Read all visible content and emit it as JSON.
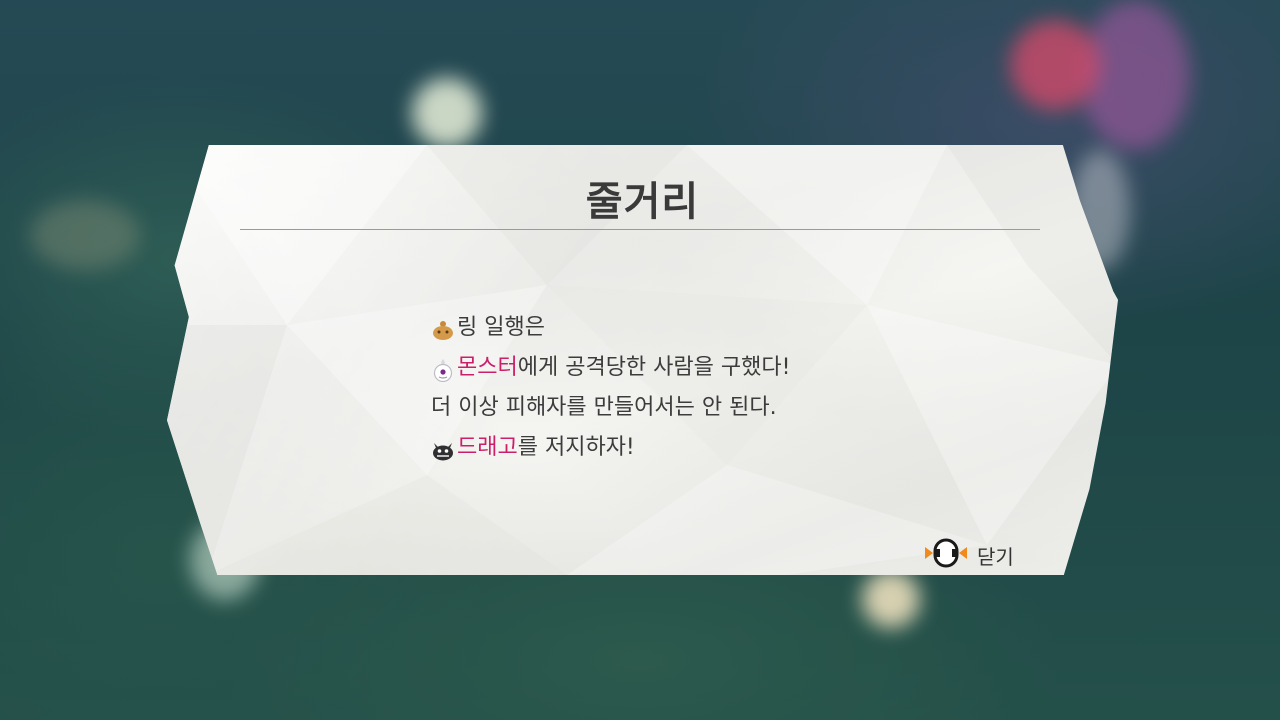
{
  "dialog": {
    "title": "줄거리",
    "lines": [
      {
        "icon": "golden-character-icon",
        "highlight": "",
        "text": "링 일행은"
      },
      {
        "icon": "white-monster-icon",
        "highlight": "몬스터",
        "text": "에게 공격당한 사람을 구했다!"
      },
      {
        "icon": "",
        "highlight": "",
        "text": "더 이상 피해자를 만들어서는 안 된다."
      },
      {
        "icon": "black-dragon-icon",
        "highlight": "드래고",
        "text": "를 저지하자!"
      }
    ],
    "close_label": "닫기",
    "close_icon": "controller-button-icon"
  },
  "colors": {
    "highlight": "#cc1f6a",
    "title": "#3a3a3a",
    "accent": "#f08a1c"
  }
}
